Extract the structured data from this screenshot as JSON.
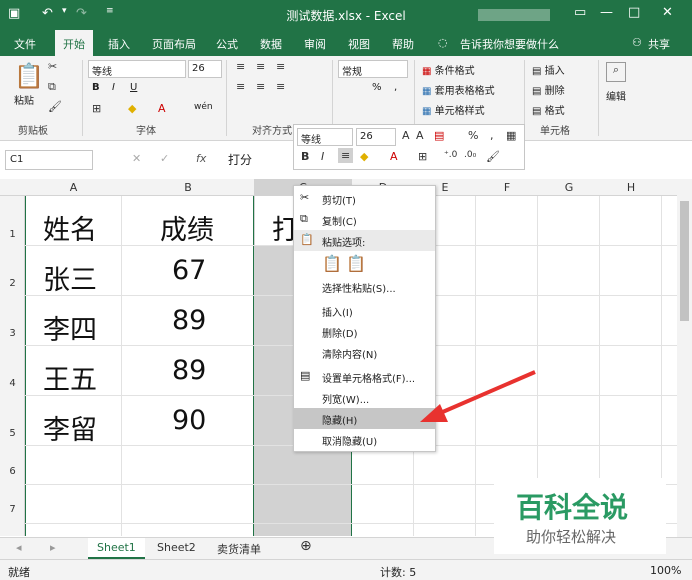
{
  "title": {
    "file": "测试数据.xlsx - Excel",
    "restore_icon": "restore-icon"
  },
  "tabs": [
    "文件",
    "开始",
    "插入",
    "页面布局",
    "公式",
    "数据",
    "审阅",
    "视图",
    "帮助"
  ],
  "tellme": "告诉我你想要做什么",
  "share": "共享",
  "ribbon": {
    "paste": "粘贴",
    "clipboard": "剪贴板",
    "font_name": "等线",
    "font_size": "26",
    "font_group": "字体",
    "align_group": "对齐方式",
    "number_format": "常规",
    "percent": "%",
    "comma": ",",
    "cond_format": "条件格式",
    "table_format": "套用表格格式",
    "cell_style": "单元格样式",
    "insert": "插入",
    "delete": "删除",
    "format": "格式",
    "cells_group": "单元格",
    "edit": "编辑",
    "bold": "B",
    "italic": "I",
    "underline": "U",
    "wen": "wén"
  },
  "namebox": "C1",
  "formula": "打分",
  "columns": [
    "A",
    "B",
    "C",
    "D",
    "E",
    "F",
    "G",
    "H"
  ],
  "rows": [
    "1",
    "2",
    "3",
    "4",
    "5",
    "6",
    "7"
  ],
  "table": [
    [
      "姓名",
      "成绩",
      "打"
    ],
    [
      "张三",
      "67"
    ],
    [
      "李四",
      "89"
    ],
    [
      "王五",
      "89"
    ],
    [
      "李留",
      "90"
    ]
  ],
  "minitoolbar": {
    "font": "等线",
    "size": "26",
    "percent": "%",
    "comma": ","
  },
  "menu": {
    "cut": "剪切(T)",
    "copy": "复制(C)",
    "paste_options": "粘贴选项:",
    "paste_special": "选择性粘贴(S)...",
    "insert": "插入(I)",
    "delete": "删除(D)",
    "clear": "清除内容(N)",
    "format_cells": "设置单元格格式(F)...",
    "col_width": "列宽(W)...",
    "hide": "隐藏(H)",
    "unhide": "取消隐藏(U)"
  },
  "sheets": [
    "Sheet1",
    "Sheet2",
    "卖货清单"
  ],
  "status": {
    "ready": "就绪",
    "count": "计数: 5",
    "zoom": "100%"
  },
  "watermark": {
    "big": "百科全说",
    "small": "助你轻松解决"
  }
}
